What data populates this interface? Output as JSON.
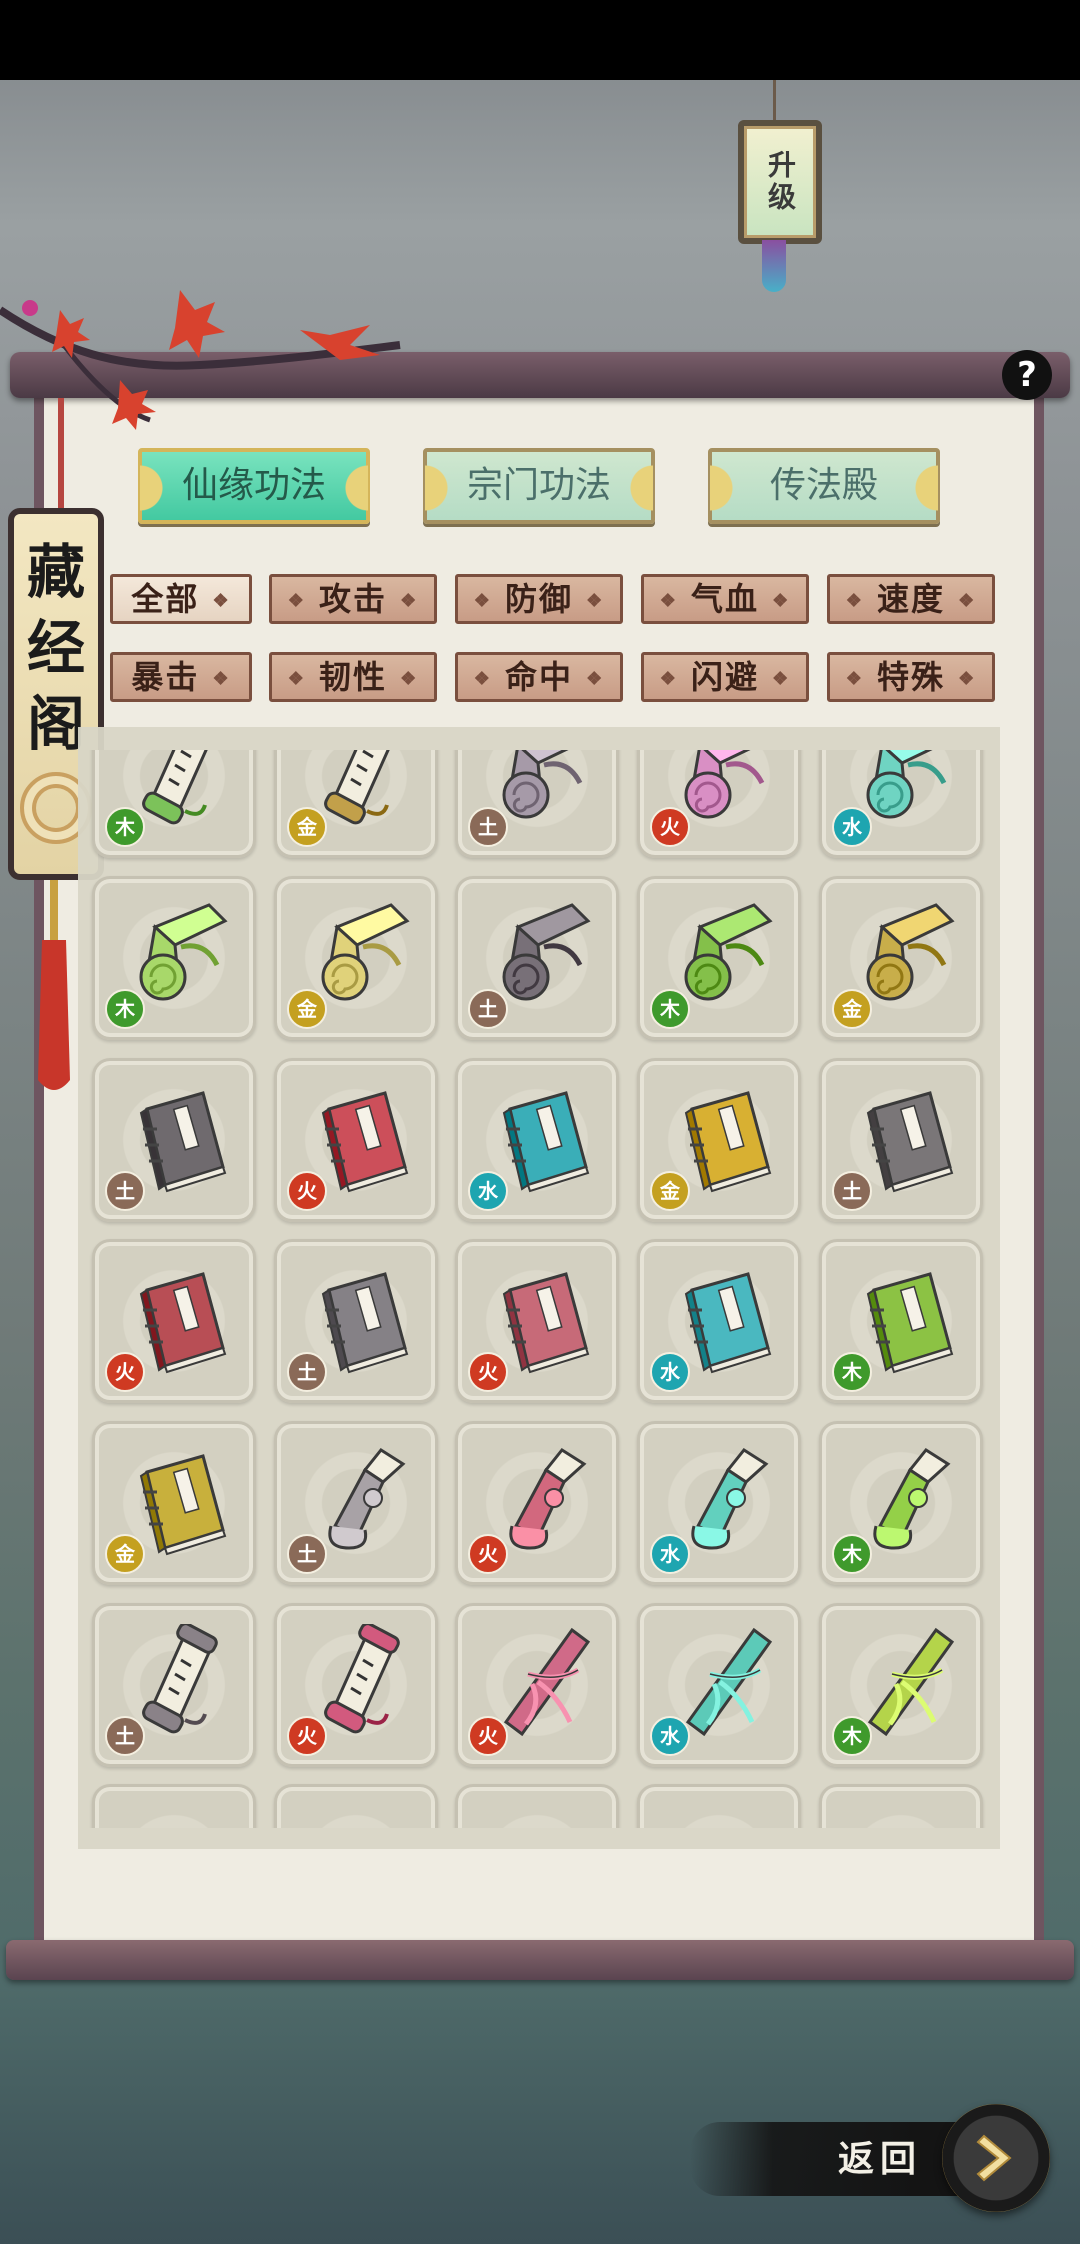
{
  "upgrade": {
    "label": "升级"
  },
  "title": {
    "text": "藏经阁"
  },
  "help": {
    "label": "?"
  },
  "tabs": [
    {
      "label": "仙缘功法",
      "active": true
    },
    {
      "label": "宗门功法",
      "active": false
    },
    {
      "label": "传法殿",
      "active": false
    }
  ],
  "filters": [
    {
      "label": "全部",
      "selected": true
    },
    {
      "label": "攻击"
    },
    {
      "label": "防御"
    },
    {
      "label": "气血"
    },
    {
      "label": "速度"
    },
    {
      "label": "暴击"
    },
    {
      "label": "韧性"
    },
    {
      "label": "命中"
    },
    {
      "label": "闪避"
    },
    {
      "label": "特殊"
    }
  ],
  "elements": {
    "木": "#3f9a2c",
    "金": "#c4a020",
    "土": "#8a6a58",
    "火": "#cf3a22",
    "水": "#1ea5b0"
  },
  "items": [
    {
      "type": "scroll-open",
      "color": "#7cc25a",
      "element": "木"
    },
    {
      "type": "scroll-open",
      "color": "#c2a04a",
      "element": "金"
    },
    {
      "type": "scroll",
      "color": "#a69aa8",
      "element": "土"
    },
    {
      "type": "scroll",
      "color": "#d98fc4",
      "element": "火"
    },
    {
      "type": "scroll",
      "color": "#6fd4c2",
      "element": "水"
    },
    {
      "type": "scroll",
      "color": "#a8d86a",
      "element": "木"
    },
    {
      "type": "scroll",
      "color": "#e0d27a",
      "element": "金"
    },
    {
      "type": "scroll",
      "color": "#787078",
      "element": "土"
    },
    {
      "type": "scroll",
      "color": "#84c04a",
      "element": "木"
    },
    {
      "type": "scroll",
      "color": "#c8ae4a",
      "element": "金"
    },
    {
      "type": "book",
      "color": "#6f6a6e",
      "element": "土"
    },
    {
      "type": "book",
      "color": "#cc4f5a",
      "element": "火"
    },
    {
      "type": "book",
      "color": "#3aaeb8",
      "element": "水"
    },
    {
      "type": "book",
      "color": "#d8b032",
      "element": "金"
    },
    {
      "type": "book",
      "color": "#7a7678",
      "element": "土"
    },
    {
      "type": "book",
      "color": "#b84e55",
      "element": "火"
    },
    {
      "type": "book",
      "color": "#858186",
      "element": "土"
    },
    {
      "type": "book",
      "color": "#c76a78",
      "element": "火"
    },
    {
      "type": "book",
      "color": "#4ab8c0",
      "element": "水"
    },
    {
      "type": "book",
      "color": "#8cc244",
      "element": "木"
    },
    {
      "type": "book",
      "color": "#c8b03c",
      "element": "金"
    },
    {
      "type": "scroll-roll",
      "color": "#a8a2a6",
      "element": "土"
    },
    {
      "type": "scroll-roll",
      "color": "#d2687e",
      "element": "火"
    },
    {
      "type": "scroll-roll",
      "color": "#62d0be",
      "element": "水"
    },
    {
      "type": "scroll-roll",
      "color": "#94d048",
      "element": "木"
    },
    {
      "type": "scroll-open",
      "color": "#8a8288",
      "element": "土"
    },
    {
      "type": "scroll-open",
      "color": "#d25a7e",
      "element": "火"
    },
    {
      "type": "scroll-tied",
      "color": "#d06a88",
      "element": "火"
    },
    {
      "type": "scroll-tied",
      "color": "#5ccab8",
      "element": "水"
    },
    {
      "type": "scroll-tied",
      "color": "#b4d44a",
      "element": "木"
    },
    {
      "type": "partial",
      "color": "#c8c4b4",
      "element": ""
    },
    {
      "type": "partial",
      "color": "#c8c4b4",
      "element": ""
    },
    {
      "type": "partial",
      "color": "#c8c4b4",
      "element": ""
    },
    {
      "type": "partial",
      "color": "#c8c4b4",
      "element": ""
    },
    {
      "type": "partial",
      "color": "#c8c4b4",
      "element": ""
    }
  ],
  "return": {
    "label": "返回"
  }
}
